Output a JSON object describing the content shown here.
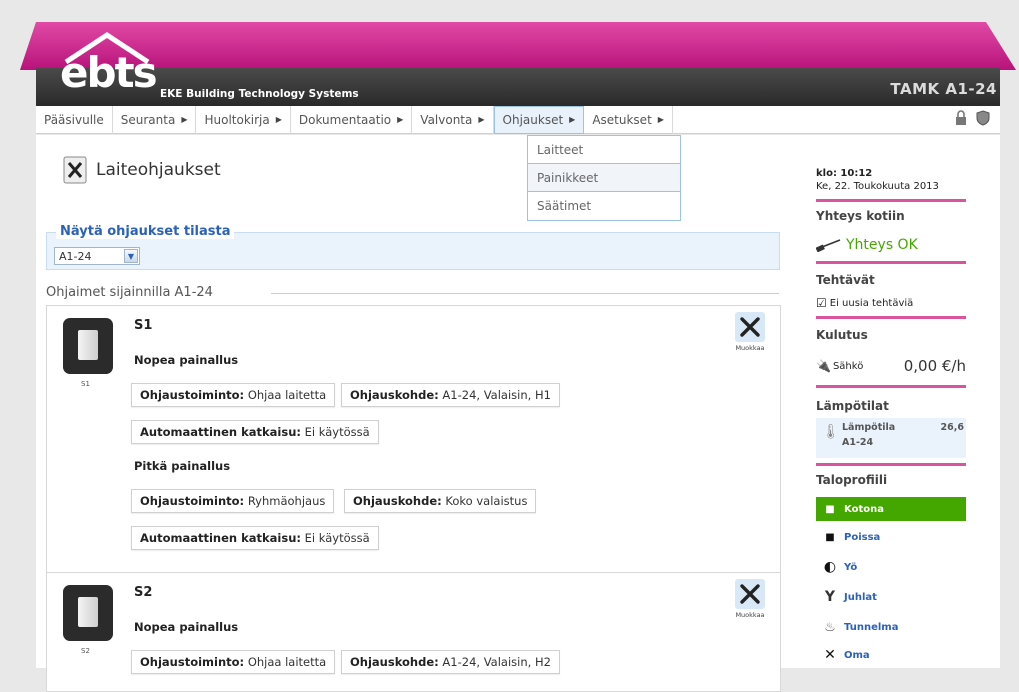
{
  "header": {
    "logo": "ebts",
    "company": "EKE Building Technology Systems",
    "site": "TAMK A1-24"
  },
  "nav": {
    "items": [
      {
        "label": "Pääsivulle",
        "arrow": false
      },
      {
        "label": "Seuranta",
        "arrow": true
      },
      {
        "label": "Huoltokirja",
        "arrow": true
      },
      {
        "label": "Dokumentaatio",
        "arrow": true
      },
      {
        "label": "Valvonta",
        "arrow": true
      },
      {
        "label": "Ohjaukset",
        "arrow": true
      },
      {
        "label": "Asetukset",
        "arrow": true
      }
    ],
    "dropdown": [
      "Laitteet",
      "Painikkeet",
      "Säätimet"
    ]
  },
  "main": {
    "title": "Laiteohjaukset",
    "filter_legend": "Näytä ohjaukset tilasta",
    "filter_value": "A1-24",
    "section_legend": "Ohjaimet sijainnilla A1-24",
    "edit_label": "Muokkaa",
    "cards": [
      {
        "title": "S1",
        "device_label": "S1",
        "short_press": "Nopea painallus",
        "function_key": "Ohjaustoiminto:",
        "function_val": "Ohjaa laitetta",
        "target_key": "Ohjauskohde:",
        "target_val": "A1-24, Valaisin, H1",
        "auto_key": "Automaattinen katkaisu:",
        "auto_val": "Ei käytössä",
        "long_press": "Pitkä painallus",
        "long_function_val": "Ryhmäohjaus",
        "long_target_val": "Koko valaistus",
        "long_auto_val": "Ei käytössä"
      },
      {
        "title": "S2",
        "device_label": "S2",
        "short_press": "Nopea painallus",
        "function_key": "Ohjaustoiminto:",
        "function_val": "Ohjaa laitetta",
        "target_key": "Ohjauskohde:",
        "target_val": "A1-24, Valaisin, H2"
      }
    ]
  },
  "sidebar": {
    "time": "klo: 10:12",
    "date": "Ke, 22. Toukokuuta 2013",
    "connection_head": "Yhteys kotiin",
    "connection_status": "Yhteys OK",
    "tasks_head": "Tehtävät",
    "tasks_text": "Ei uusia tehtäviä",
    "consumption_head": "Kulutus",
    "consumption_label": "Sähkö",
    "consumption_value": "0,00 €/h",
    "temps_head": "Lämpötilat",
    "temp_label": "Lämpötila",
    "temp_location": "A1-24",
    "temp_value": "26,6",
    "profile_head": "Taloprofiili",
    "profiles": [
      {
        "label": "Kotona",
        "icon": "home-icon",
        "active": true
      },
      {
        "label": "Poissa",
        "icon": "away-icon",
        "active": false
      },
      {
        "label": "Yö",
        "icon": "night-icon",
        "active": false
      },
      {
        "label": "Juhlat",
        "icon": "party-icon",
        "active": false
      },
      {
        "label": "Tunnelma",
        "icon": "mood-icon",
        "active": false
      },
      {
        "label": "Oma",
        "icon": "custom-icon",
        "active": false
      }
    ]
  },
  "colors": {
    "accent_pink": "#d9539f",
    "roof_magenta": "#c01a7f",
    "active_green": "#44a700",
    "link_blue": "#2b62b8",
    "status_green": "#44a700"
  }
}
